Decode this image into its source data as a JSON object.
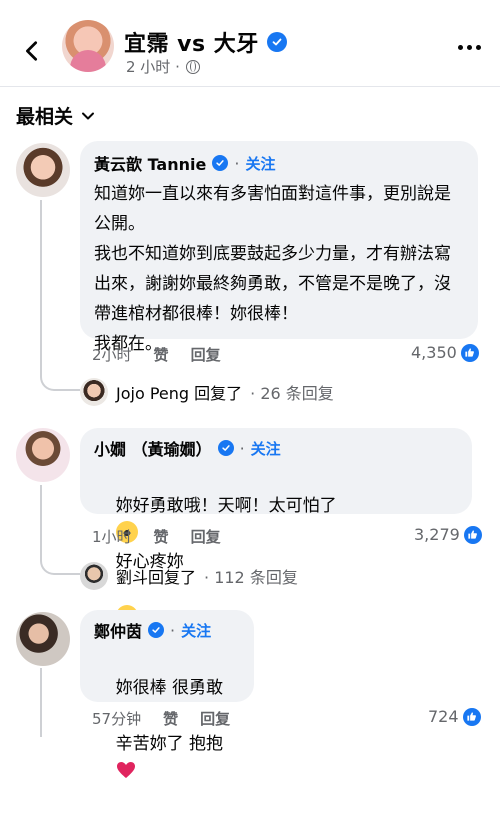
{
  "header": {
    "title": "宜霈 vs 大牙",
    "time": "2 小时 ·"
  },
  "sort": {
    "label": "最相关"
  },
  "comments": [
    {
      "name": "黃云歆 Tannie",
      "follow": "关注",
      "text": "知道妳一直以來有多害怕面對這件事，更別說是公開。\n我也不知道妳到底要鼓起多少力量，才有辦法寫出來，謝謝妳最終夠勇敢，不管是不是晚了，沒帶進棺材都很棒！妳很棒！\n我都在。",
      "time": "2小时",
      "like": "赞",
      "reply": "回复",
      "reactions": "4,350",
      "reply_by": "Jojo Peng 回复了",
      "reply_count": "· 26 条回复"
    },
    {
      "name": "小嫺 （黃瑜嫺）",
      "follow": "关注",
      "text_a": "妳好勇敢哦！天啊！太可怕了",
      "text_b": "好心疼妳",
      "time": "1小时",
      "like": "赞",
      "reply": "回复",
      "reactions": "3,279",
      "reply_by": "劉斗回复了",
      "reply_count": "· 112 条回复"
    },
    {
      "name": "鄭仲茵",
      "follow": "关注",
      "text_a": "妳很棒 很勇敢",
      "text_b": "辛苦妳了 抱抱",
      "time": "57分钟",
      "like": "赞",
      "reply": "回复",
      "reactions": "724"
    }
  ],
  "colors": {
    "link": "#1877f2",
    "bubble": "#f0f2f5",
    "muted": "#65676b"
  }
}
